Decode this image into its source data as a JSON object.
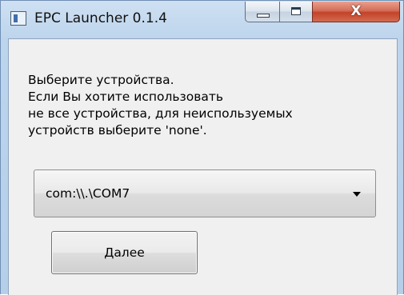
{
  "window": {
    "title": "EPC Launcher 0.1.4",
    "caption_buttons": {
      "minimize_icon": "minimize-icon",
      "maximize_icon": "maximize-icon",
      "close_icon": "close-icon",
      "close_glyph": "X"
    },
    "colors": {
      "frame": "#bcd4ec",
      "client_background": "#f0f0f0",
      "close_button": "#c2432a"
    }
  },
  "content": {
    "message_lines": [
      "Выберите устройства.",
      "Если Вы хотите использовать",
      "не все устройства, для неиспользуемых",
      "устройств выберите 'none'."
    ],
    "device_select": {
      "selected_value": "com:\\\\.\\COM7",
      "arrow_icon": "chevron-down-icon"
    },
    "next_button_label": "Далее"
  }
}
